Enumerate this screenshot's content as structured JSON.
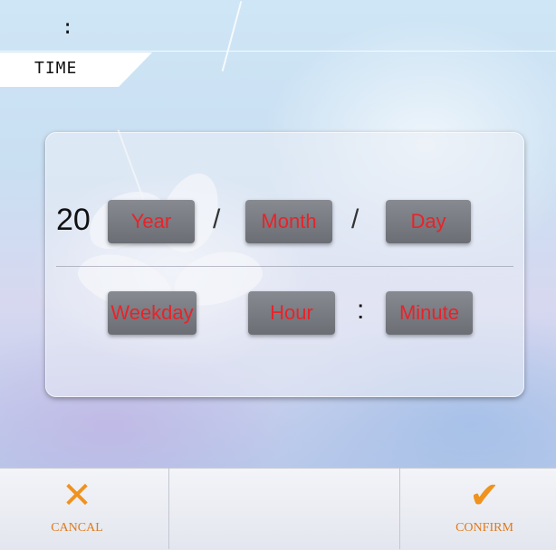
{
  "header": {
    "colon": ":",
    "tab_label": "TIME"
  },
  "date_row": {
    "century_prefix": "20",
    "year": "Year",
    "separator_1": "/",
    "month": "Month",
    "separator_2": "/",
    "day": "Day"
  },
  "time_row": {
    "weekday": "Weekday",
    "hour": "Hour",
    "separator": ":",
    "minute": "Minute"
  },
  "footer": {
    "cancel_label": "CANCAL",
    "confirm_label": "CONFIRM",
    "cancel_icon": "x-icon",
    "confirm_icon": "checkmark-icon"
  },
  "colors": {
    "field_text": "#e8232a",
    "action_accent": "#f0921e"
  }
}
